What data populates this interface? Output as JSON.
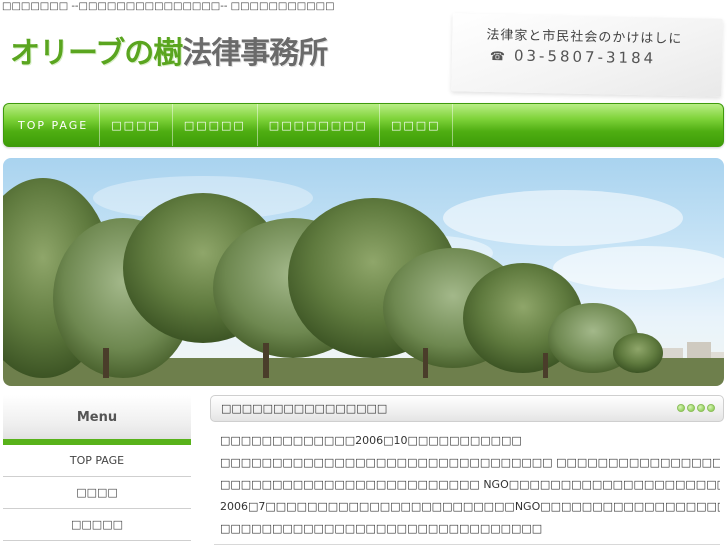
{
  "top_banner_text": "□□□□□□□ --□□□□□□□□□□□□□□□-- □□□□□□□□□□□",
  "logo": {
    "green_text": "オリーブの樹",
    "gray_text": "法律事務所"
  },
  "contact": {
    "tagline": "法律家と市民社会のかけはしに",
    "phone_icon": "phone-icon",
    "phone": "03-5807-3184"
  },
  "nav": {
    "items": [
      {
        "label": "TOP PAGE"
      },
      {
        "label": "□□□□"
      },
      {
        "label": "□□□□□"
      },
      {
        "label": "□□□□□□□□"
      },
      {
        "label": "□□□□"
      }
    ]
  },
  "sidebar": {
    "heading": "Menu",
    "items": [
      {
        "label": "TOP PAGE"
      },
      {
        "label": "□□□□"
      },
      {
        "label": "□□□□□"
      }
    ]
  },
  "main": {
    "heading": "□□□□□□□□□□□□□□□□",
    "lines": [
      "□□□□□□□□□□□□□2006□10□□□□□□□□□□□",
      "□□□□□□□□□□□□□□□□□□□□□□□□□□□□□□□□ □□□□□□□□□□□□□□□□□□□□□□□□□□□□□□□□□□□□□□□□□□",
      "□□□□□□□□□□□□□□□□□□□□□□□□□ NGO□□□□□□□□□□□□□□□□□□□□□□□□□□□□□□□□□□□□□□□□□□",
      "2006□7□□□□□□□□□□□□□□□□□□□□□□□□NGO□□□□□□□□□□□□□□□□□□□□□□□□□□□□□□□□ □□□",
      "□□□□□□□□□□□□□□□□□□□□□□□□□□□□□□□"
    ]
  },
  "colors": {
    "accent_green": "#58b21a",
    "nav_dark": "#3d9c08",
    "logo_gray": "#6a6a6a"
  }
}
